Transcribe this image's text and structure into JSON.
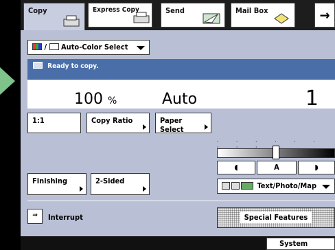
{
  "tabs": [
    {
      "label": "Copy",
      "icon": "copier-icon"
    },
    {
      "label": "Express Copy",
      "icon": "copier-icon"
    },
    {
      "label": "Send",
      "icon": "send-icon"
    },
    {
      "label": "Mail Box",
      "icon": "mailbox-icon"
    }
  ],
  "tab_next_arrow": "→",
  "color_select": {
    "label": "Auto-Color Select",
    "divider": "/"
  },
  "status": {
    "text": "Ready to copy."
  },
  "readout": {
    "ratio_value": "100",
    "ratio_unit": "%",
    "paper": "Auto",
    "quantity": "1"
  },
  "buttons": {
    "one_to_one": "1:1",
    "copy_ratio": "Copy Ratio",
    "paper_select": "Paper Select",
    "finishing": "Finishing",
    "two_sided": "2-Sided",
    "interrupt": "Interrupt",
    "special_features": "Special Features",
    "system_monitor": "System Monitor"
  },
  "density": {
    "light": "◖",
    "auto": "A",
    "dark": "◗",
    "level": 0.5
  },
  "mode_select": {
    "label": "Text/Photo/Map"
  },
  "colors": {
    "accent": "#4a6fa8",
    "screen_bg": "#b9c0d6",
    "arrow": "#7fc28a"
  }
}
